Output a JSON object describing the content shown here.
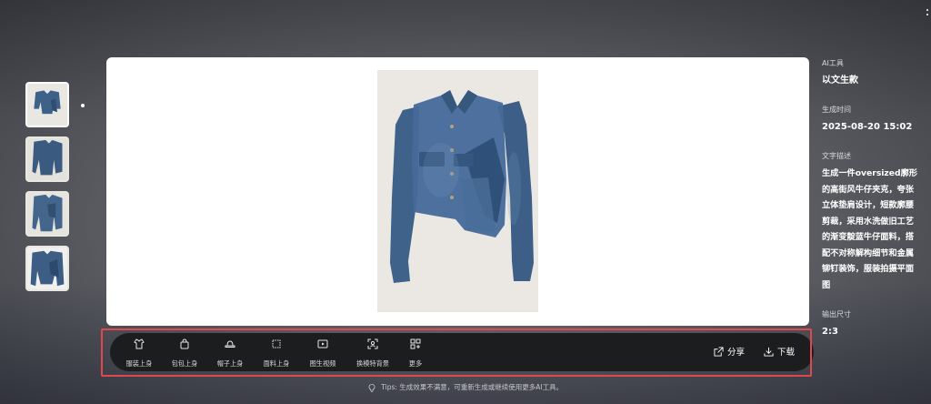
{
  "thumbnails": [
    {
      "name": "thumb-1",
      "active": true
    },
    {
      "name": "thumb-2",
      "active": false
    },
    {
      "name": "thumb-3",
      "active": false
    },
    {
      "name": "thumb-4",
      "active": false
    }
  ],
  "info": {
    "ai_tool_label": "AI工具",
    "ai_tool_value": "以文生款",
    "time_label": "生成时间",
    "time_value": "2025-08-20 15:02",
    "desc_label": "文字描述",
    "desc_value": "生成一件oversized廓形的高街风牛仔夹克，夸张立体垫肩设计，短款廓腰剪裁，采用水洗做旧工艺的渐变靛蓝牛仔面料，搭配不对称解构细节和金属铆钉装饰，服装拍摄平面图",
    "size_label": "输出尺寸",
    "size_value": "2:3"
  },
  "toolbar": {
    "tools": [
      {
        "label": "服装上身",
        "icon": "shirt-icon"
      },
      {
        "label": "包包上身",
        "icon": "bag-icon"
      },
      {
        "label": "帽子上身",
        "icon": "hat-icon"
      },
      {
        "label": "面料上身",
        "icon": "fabric-icon"
      },
      {
        "label": "图生视频",
        "icon": "video-icon"
      },
      {
        "label": "换模特背景",
        "icon": "scan-person-icon"
      },
      {
        "label": "更多",
        "icon": "grid-plus-icon"
      }
    ],
    "share_label": "分享",
    "download_label": "下载"
  },
  "tips": "Tips: 生成效果不满意，可重新生成或继续使用更多AI工具。",
  "colors": {
    "toolbar_bg": "#1c1d1f",
    "highlight_border": "#e0484d",
    "denim": "#3d5f86"
  }
}
